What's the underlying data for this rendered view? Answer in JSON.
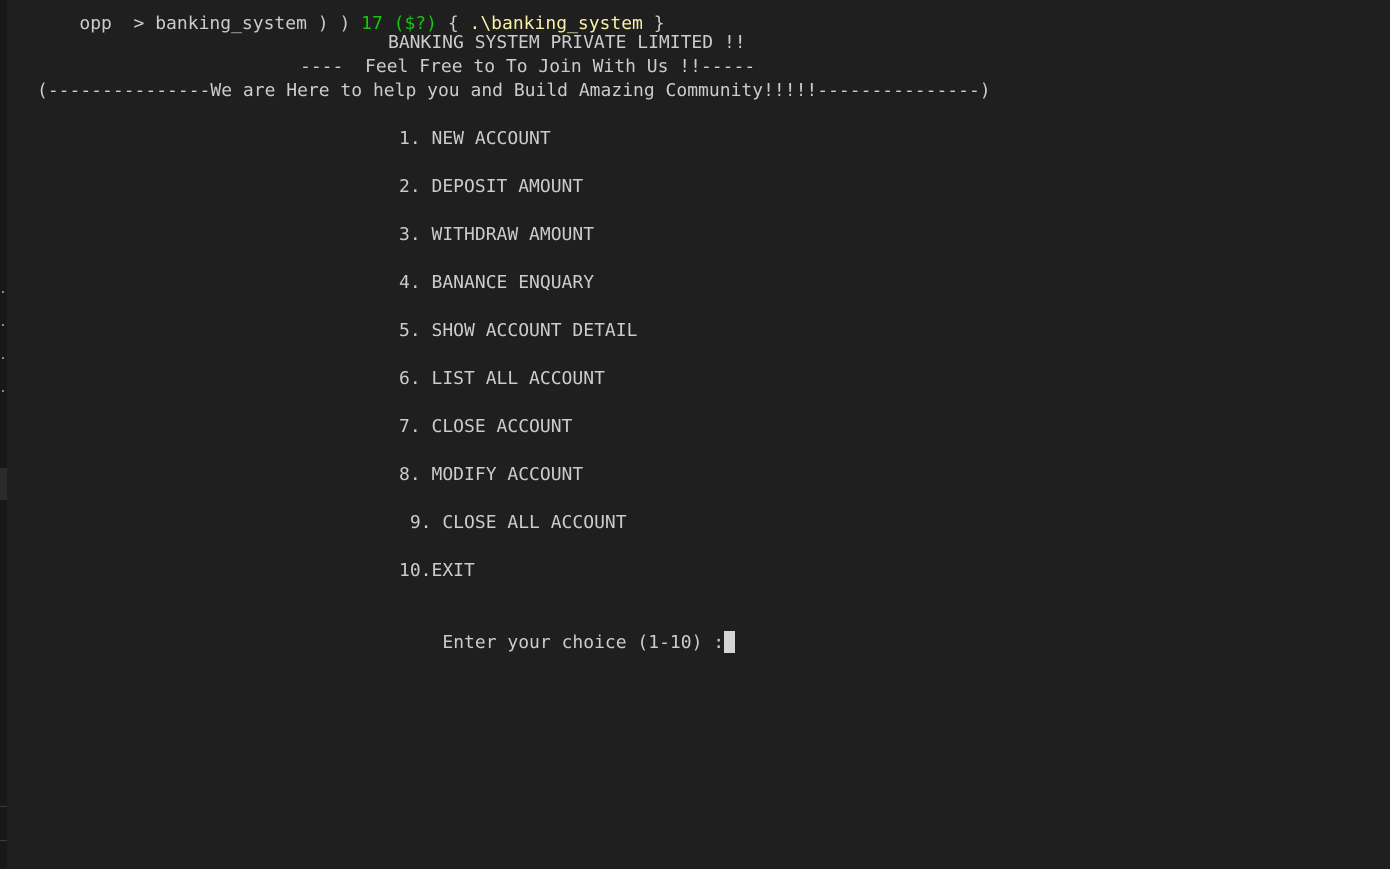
{
  "terminal": {
    "prompt_partial": {
      "text_a": "opp  > banking_system ) ) ",
      "text_b": "17 ($?)",
      "text_c": " { ",
      "text_d": ".\\banking_system",
      "text_e": " }"
    },
    "header": {
      "title": "BANKING SYSTEM PRIVATE LIMITED !!",
      "subtitle": "----  Feel Free to To Join With Us !!-----",
      "tagline": "(---------------We are Here to help you and Build Amazing Community!!!!!---------------)"
    },
    "menu": [
      "1. NEW ACCOUNT",
      "2. DEPOSIT AMOUNT",
      "3. WITHDRAW AMOUNT",
      "4. BANANCE ENQUARY",
      "5. SHOW ACCOUNT DETAIL",
      "6. LIST ALL ACCOUNT",
      "7. CLOSE ACCOUNT",
      "8. MODIFY ACCOUNT",
      " 9. CLOSE ALL ACCOUNT",
      "10.EXIT"
    ],
    "input_prompt": "Enter your choice (1-10) :",
    "input_value": ""
  },
  "colors": {
    "background": "#1f1f1f",
    "text": "#cccccc",
    "prompt_green": "#16c60c",
    "prompt_yellow": "#f9f1a5",
    "cursor": "#d4d4d4"
  }
}
